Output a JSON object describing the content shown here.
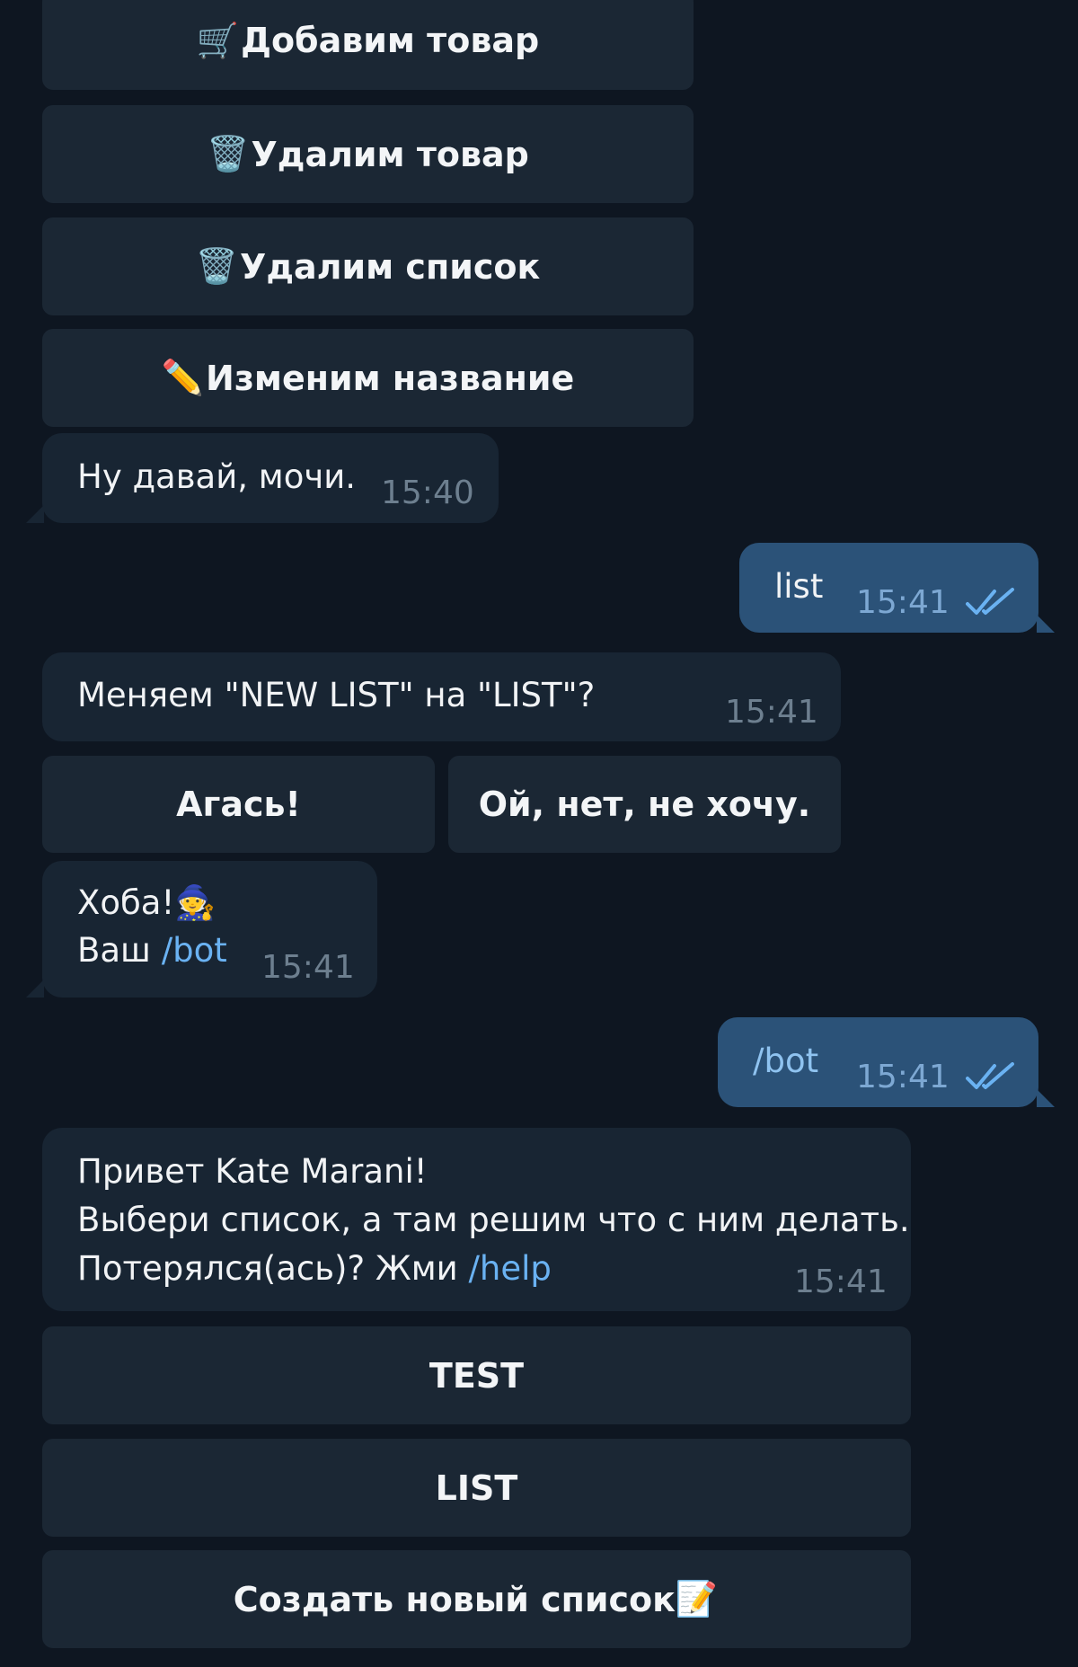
{
  "keyboard_top": {
    "add_item": {
      "emoji": "🛒",
      "label": "Добавим товар"
    },
    "delete_item": {
      "emoji": "🗑️",
      "label": "Удалим товар"
    },
    "delete_list": {
      "emoji": "🗑️",
      "label": "Удалим список"
    },
    "rename": {
      "emoji": "✏️",
      "label": "Изменим название"
    }
  },
  "messages": {
    "m1": {
      "text": "Ну давай, мочи.",
      "time": "15:40"
    },
    "m2": {
      "text": "list",
      "time": "15:41"
    },
    "m3": {
      "text": "Меняем \"NEW LIST\" на \"LIST\"?",
      "time": "15:41"
    },
    "m4": {
      "line1": "Хоба!",
      "line1_emoji": "🧙",
      "line2_prefix": "Ваш",
      "line2_link": "/bot",
      "time": "15:41"
    },
    "m5": {
      "text": "/bot",
      "time": "15:41"
    },
    "m6": {
      "line1": "Привет Kate Marani!",
      "line2": "Выбери список, а там решим что с ним делать.",
      "line3_prefix": "Потерялся(ась)? Жми",
      "line3_link": "/help",
      "time": "15:41"
    }
  },
  "confirm": {
    "yes": "Агась!",
    "no": "Ой, нет, не хочу."
  },
  "lists": {
    "test": "TEST",
    "list": "LIST",
    "create": {
      "label": "Создать новый список",
      "emoji": "📝"
    }
  },
  "colors": {
    "background": "#0e1621",
    "incoming_bubble": "#182533",
    "outgoing_bubble": "#2b5278",
    "keyboard_button": "#1b2734",
    "link": "#6ab2f2",
    "read_check": "#6ab2f2"
  }
}
